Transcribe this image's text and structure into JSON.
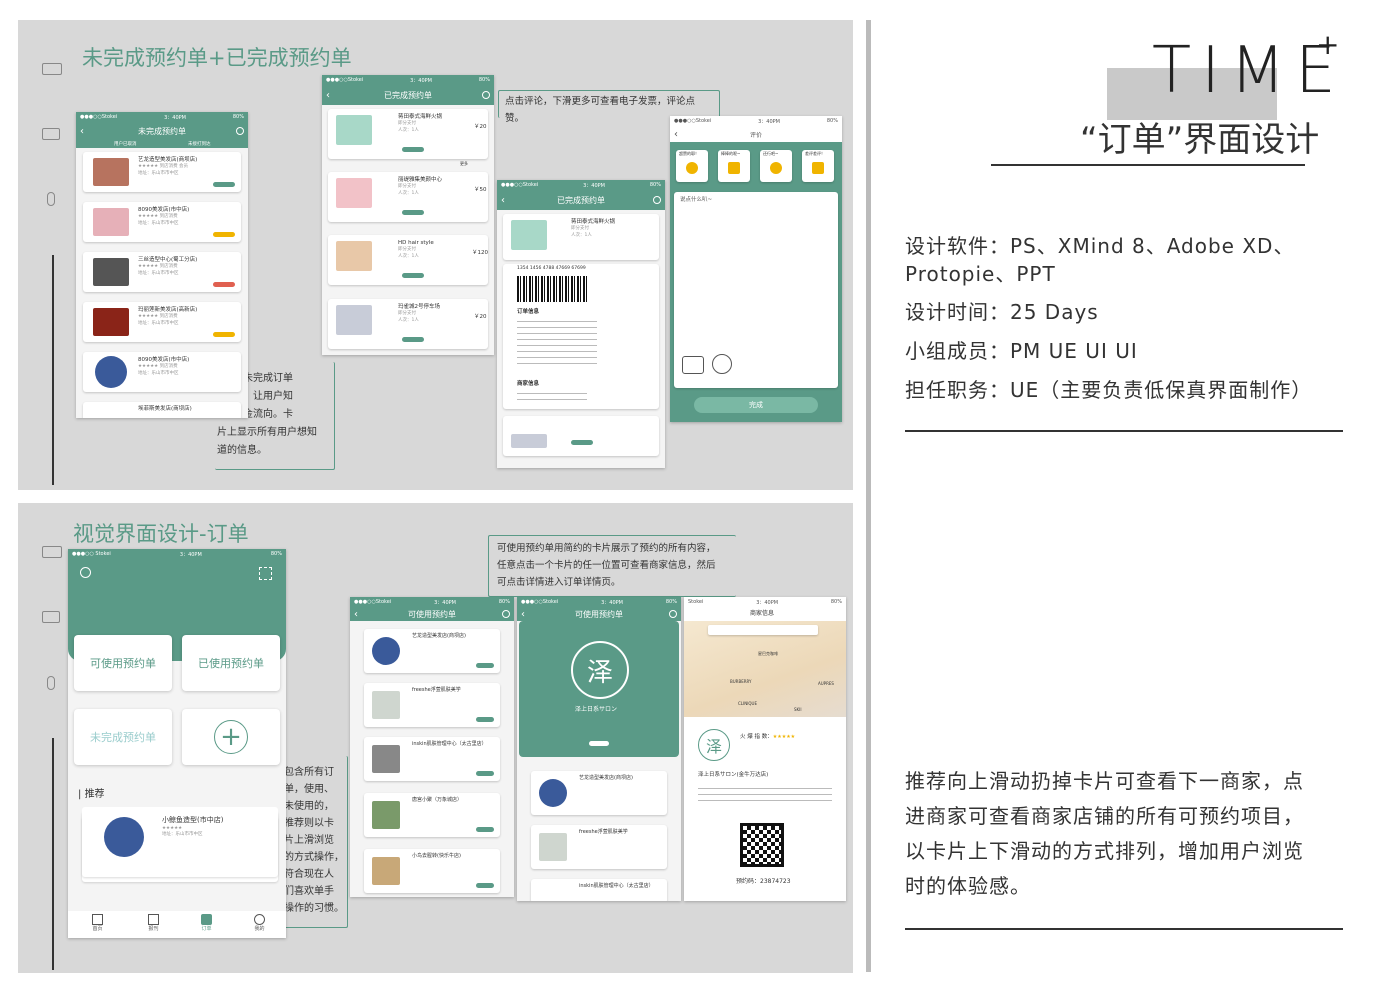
{
  "header": {
    "title": "TIME",
    "plus": "+",
    "subtitle": "“订单”界面设计"
  },
  "info": {
    "software": "设计软件：PS、XMind 8、Adobe XD、",
    "software2": "Protopie、PPT",
    "time": "设计时间：25 Days",
    "team": "小组成员：PM UE UI UI",
    "role": "担任职务：UE（主要负责低保真界面制作）"
  },
  "bottom_desc": [
    "推荐向上滑动扔掉卡片可查看下一商家，点",
    "进商家可查看商家店铺的所有可预约项目，",
    "以卡片上下滑动的方式排列，增加用户浏览",
    "时的体验感。"
  ],
  "top_panel": {
    "title": "未完成预约单+已完成预约单",
    "callout_left": [
      "显示未完成订单",
      "详情，让用户知",
      "道资金流向。卡",
      "片上显示所有用户想知",
      "道的信息。"
    ],
    "callout_top": "点击评论，下滑更多可查看电子发票，评论点赞。",
    "phone1": {
      "status": [
        "●●●○○Stokei",
        "3：40PM",
        "80%"
      ],
      "title": "未完成预约单",
      "tabs": [
        "用户已取消",
        "未接打到达"
      ],
      "stores": [
        "艺龙造型美发店(商坝店)",
        "8090美发店(市中店)",
        "三丝造型中心(蜀工分店)",
        "玛丽莲新美发店(高新店)",
        "8090美发店(市中店)",
        "埃菲斯美发店(商坝店)"
      ]
    },
    "phone2": {
      "status": [
        "●●●○○Stokei",
        "3：40PM",
        "80%"
      ],
      "title": "已完成预约单",
      "stores": [
        "蒋田泰式海鲜火锅",
        "丽缇雅集美颜中心",
        "HD hair style",
        "玛雀城2号停车场"
      ],
      "prices": [
        "￥20",
        "￥50",
        "￥120",
        "￥20"
      ],
      "more": "更多"
    },
    "phone3": {
      "status": [
        "●●●○○Stokei",
        "3：40PM",
        "80%"
      ],
      "title": "已完成预约单",
      "store": "蒋田泰式海鲜火锅",
      "barcode_no": "1354 1456 4788 47669 67699",
      "order_title": "订单信息",
      "merchant_title": "商家信息"
    },
    "phone4": {
      "status": [
        "●●●○○Stokei",
        "3：40PM",
        "80%"
      ],
      "title": "评价",
      "emojis": [
        "超赞的耶！",
        "棒棒的呢~",
        "还行吧~",
        "差评差评！"
      ],
      "placeholder": "说点什么叭~",
      "done": "完成"
    }
  },
  "bottom_panel": {
    "title": "视觉界面设计-订单",
    "callout_top": [
      "可使用预约单用简约的卡片展示了预约的所有内容，",
      "任意点击一个卡片的任一位置可查看商家信息，然后",
      "可点击详情进入订单详情页。"
    ],
    "callout_left": [
      "包含所有订",
      "单，使用、",
      "未使用的，",
      "推荐则以卡",
      "片上滑浏览",
      "的方式操作，",
      "符合现在人",
      "们喜欢单手",
      "操作的习惯。"
    ],
    "phone1": {
      "status": [
        "●●●○○ Stokei",
        "3：40PM",
        "80%"
      ],
      "buttons": [
        "可使用预约单",
        "已使用预约单",
        "未完成预约单"
      ],
      "recommend": "推荐",
      "rec_store": "小鲸鱼造型(市中店)",
      "tabs": [
        "首页",
        "报刊",
        "订单",
        "我的"
      ]
    },
    "phone2": {
      "status": [
        "●●●○○Stokei",
        "3：40PM",
        "80%"
      ],
      "title": "可使用预约单",
      "stores": [
        "艺龙造型美发店(商坝店)",
        "freeshe浮萱肌肤美学",
        "inskin肌肤管理中心（太古里店）",
        "唐宫小聚（万象城店）",
        "小鸟去腥转(快乐牛店)"
      ]
    },
    "phone3": {
      "status": [
        "●●●○○Stokei",
        "3：40PM",
        "80%"
      ],
      "title": "可使用预约单",
      "brand": "泽上日系サロン",
      "stores": [
        "艺龙造型美发店(商坝店)",
        "freeshe浮萱肌肤美学",
        "inskin肌肤管理中心（太古里店）"
      ]
    },
    "phone4": {
      "status": [
        "Stokei",
        "3：40PM",
        "80%"
      ],
      "title": "商家信息",
      "hot_label": "火 爆 指 数：",
      "store": "泽上日系サロン(金牛万达店)",
      "code": "预约码：23874723",
      "map_labels": [
        "星巴克咖啡",
        "BURBERRY",
        "CLINIQUE",
        "AUPRES",
        "SKII"
      ]
    }
  },
  "colors": {
    "accent": "#5a9a87",
    "panel": "#d8d8d8"
  }
}
